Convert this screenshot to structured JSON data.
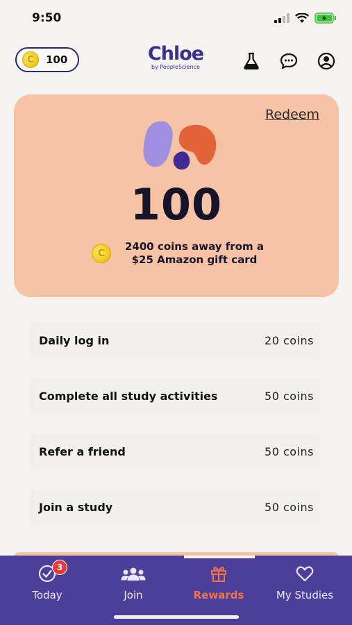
{
  "status": {
    "time": "9:50"
  },
  "header": {
    "coin_balance": "100",
    "coin_symbol": "C",
    "logo_text": "Chloe",
    "logo_subtext": "by PeopleScience",
    "icons": [
      "lab-flask-icon",
      "chat-icon",
      "profile-icon"
    ]
  },
  "card": {
    "redeem_label": "Redeem",
    "value": "100",
    "coin_symbol": "C",
    "message": "2400 coins away from a $25 Amazon gift card"
  },
  "rewards": [
    {
      "label": "Daily log in",
      "coins": "20 coins"
    },
    {
      "label": "Complete all study activities",
      "coins": "50 coins"
    },
    {
      "label": "Refer a friend",
      "coins": "50 coins"
    },
    {
      "label": "Join a study",
      "coins": "50 coins"
    }
  ],
  "tabs": [
    {
      "label": "Today",
      "icon": "check-circle-icon",
      "badge": "3"
    },
    {
      "label": "Join",
      "icon": "people-icon"
    },
    {
      "label": "Rewards",
      "icon": "gift-icon",
      "active": true
    },
    {
      "label": "My Studies",
      "icon": "heart-icon"
    }
  ],
  "colors": {
    "card_bg": "#f6c4a4",
    "tab_bar": "#4b3f9a",
    "active_tab": "#f0744a",
    "brand": "#3a2f8c"
  }
}
